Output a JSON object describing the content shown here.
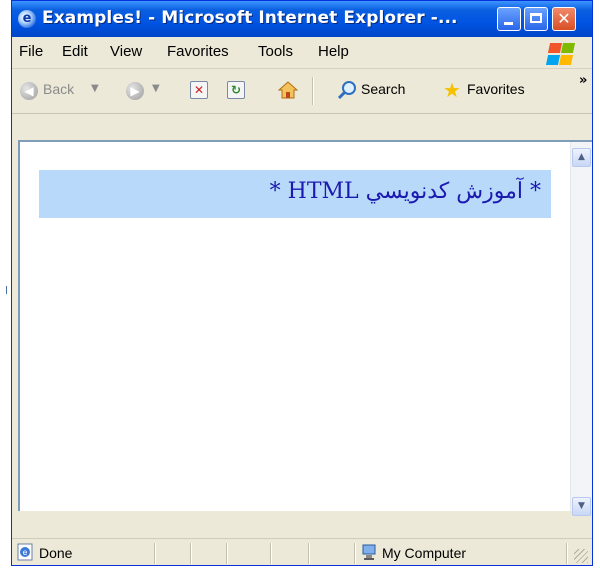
{
  "window": {
    "title": "Examples! - Microsoft Internet Explorer -...",
    "title_icon": "ie-icon"
  },
  "menu": [
    "File",
    "Edit",
    "View",
    "Favorites",
    "Tools",
    "Help"
  ],
  "toolbar": {
    "back_label": "Back",
    "search_label": "Search",
    "favorites_label": "Favorites",
    "overflow": "»"
  },
  "page": {
    "banner_text": "* آموزش كدنويسي HTML *",
    "banner_bg": "#b9d9fb",
    "text_color": "#1a1ab0"
  },
  "status": {
    "left": "Done",
    "zone": "My Computer"
  },
  "colors": {
    "titlebar": "#0054e3",
    "chrome": "#ece9d8"
  }
}
